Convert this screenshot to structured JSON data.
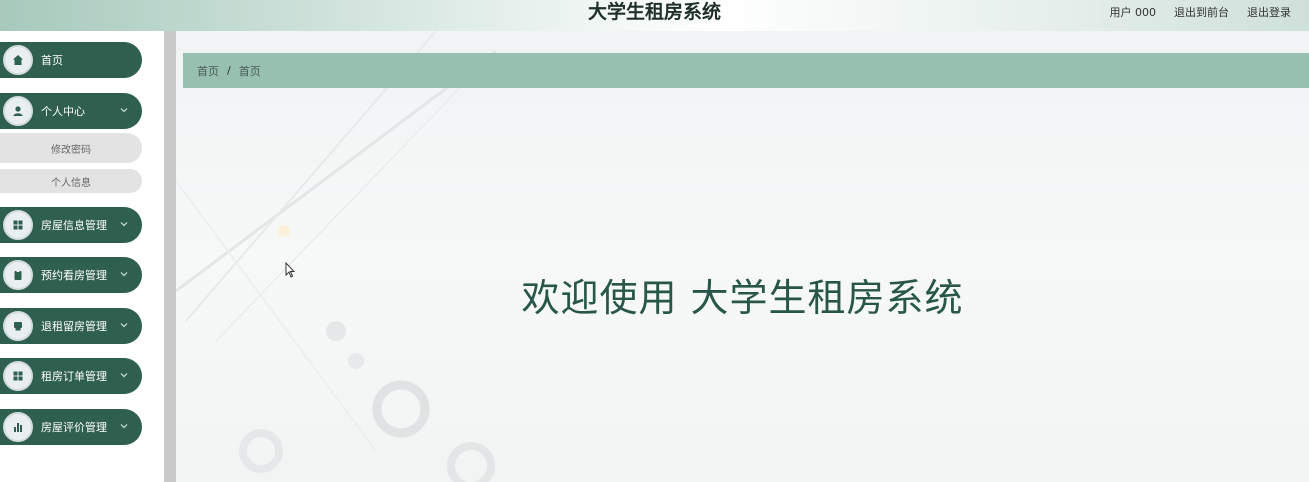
{
  "header": {
    "title": "大学生租房系统",
    "links": [
      {
        "label": "用户 000"
      },
      {
        "label": "退出到前台"
      },
      {
        "label": "退出登录"
      }
    ]
  },
  "sidebar": {
    "items": [
      {
        "label": "首页",
        "icon": "home-icon",
        "has_children": false
      },
      {
        "label": "个人中心",
        "icon": "user-icon",
        "has_children": true,
        "children": [
          {
            "label": "修改密码"
          },
          {
            "label": "个人信息"
          }
        ]
      },
      {
        "label": "房屋信息管理",
        "icon": "grid-icon",
        "has_children": true
      },
      {
        "label": "预约看房管理",
        "icon": "clipboard-icon",
        "has_children": true
      },
      {
        "label": "退租留房管理",
        "icon": "box-icon",
        "has_children": true
      },
      {
        "label": "租房订单管理",
        "icon": "grid-icon",
        "has_children": true
      },
      {
        "label": "房屋评价管理",
        "icon": "bar-chart-icon",
        "has_children": true
      }
    ]
  },
  "breadcrumb": [
    {
      "label": "首页"
    },
    {
      "label": "首页"
    }
  ],
  "breadcrumb_separator": "/",
  "main": {
    "welcome_text": "欢迎使用  大学生租房系统"
  },
  "colors": {
    "sidebar_item_bg": "#2f5f4f",
    "breadcrumb_bg": "#97c0b1",
    "welcome_text": "#28574a"
  }
}
